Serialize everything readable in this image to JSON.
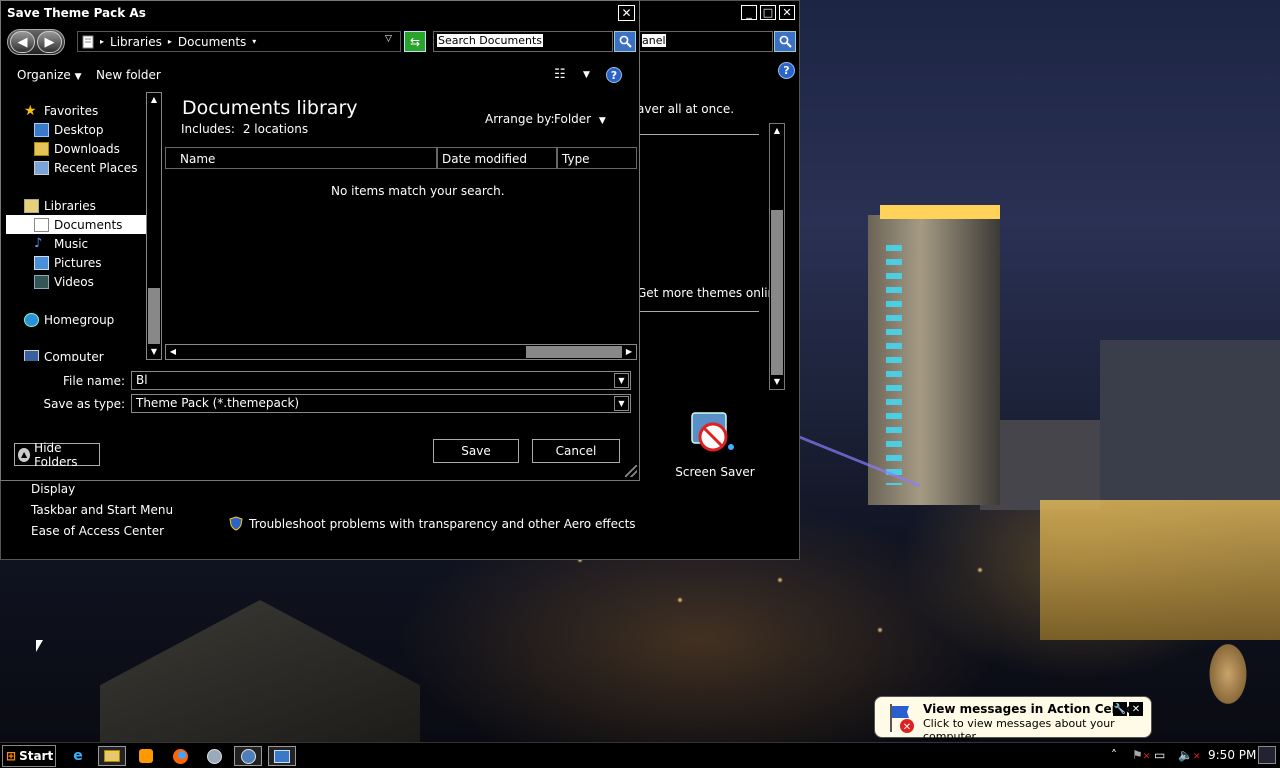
{
  "dialog": {
    "title": "Save Theme Pack As",
    "close": "✕",
    "address": {
      "crumbs": [
        "Libraries",
        "Documents"
      ]
    },
    "search": {
      "value": "Search Documents"
    },
    "toolbar": {
      "organize": "Organize",
      "new_folder": "New folder",
      "help": "?"
    },
    "nav": {
      "favorites_header": "Favorites",
      "favorites": [
        "Desktop",
        "Downloads",
        "Recent Places"
      ],
      "libraries_header": "Libraries",
      "libraries": [
        "Documents",
        "Music",
        "Pictures",
        "Videos"
      ],
      "selected": "Documents",
      "homegroup": "Homegroup",
      "computer": "Computer"
    },
    "library": {
      "title": "Documents library",
      "includes_label": "Includes:",
      "includes_value": "2 locations",
      "arrange_label": "Arrange by:",
      "arrange_value": "Folder"
    },
    "columns": [
      "Name",
      "Date modified",
      "Type"
    ],
    "empty_message": "No items match your search.",
    "file_name_label": "File name:",
    "file_name_value": "Bl",
    "save_type_label": "Save as type:",
    "save_type_value": "Theme Pack (*.themepack)",
    "save_button": "Save",
    "cancel_button": "Cancel",
    "hide_folders": "Hide Folders"
  },
  "background_window": {
    "search_value": "anel",
    "text_top": "aver all at once.",
    "text_more": "Get more themes online",
    "screen_saver_label": "Screen Saver",
    "links": [
      "Display",
      "Taskbar and Start Menu",
      "Ease of Access Center"
    ],
    "troubleshoot": "Troubleshoot problems with transparency and other Aero effects"
  },
  "taskbar": {
    "start_label": "Start",
    "clock": "9:50 PM"
  },
  "balloon": {
    "title": "View messages in Action Center",
    "subtitle": "Click to view messages about your computer."
  },
  "colors": {
    "accent_blue": "#3b70c4",
    "selection": "#ffffff",
    "refresh_green": "#2aa32a"
  }
}
